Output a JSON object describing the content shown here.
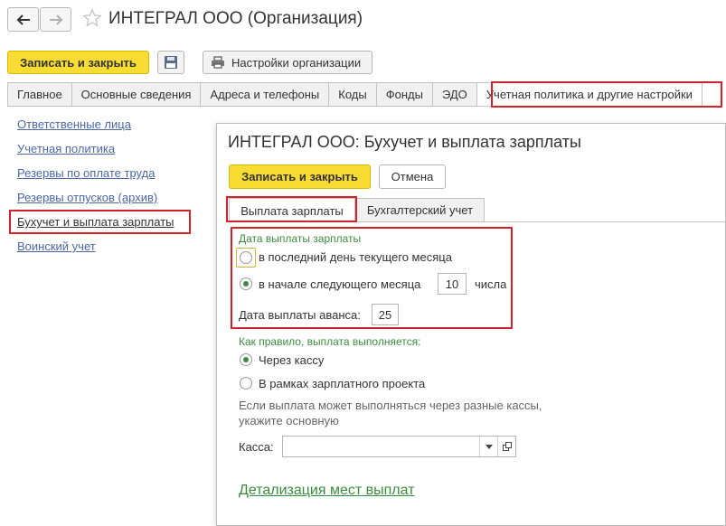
{
  "window": {
    "title": "ИНТЕГРАЛ ООО (Организация)"
  },
  "toolbar": {
    "save_close_label": "Записать и закрыть",
    "settings_label": "Настройки организации"
  },
  "tabs": [
    {
      "label": "Главное"
    },
    {
      "label": "Основные сведения"
    },
    {
      "label": "Адреса и телефоны"
    },
    {
      "label": "Коды"
    },
    {
      "label": "Фонды"
    },
    {
      "label": "ЭДО"
    },
    {
      "label": "Учетная политика и другие настройки"
    }
  ],
  "sidebar": {
    "items": [
      {
        "label": "Ответственные лица"
      },
      {
        "label": "Учетная политика"
      },
      {
        "label": "Резервы по оплате труда"
      },
      {
        "label": "Резервы отпусков (архив)"
      },
      {
        "label": "Бухучет и выплата зарплаты"
      },
      {
        "label": "Воинский учет"
      }
    ]
  },
  "dialog": {
    "title": "ИНТЕГРАЛ ООО: Бухучет и выплата зарплаты",
    "save_close_label": "Записать и закрыть",
    "cancel_label": "Отмена",
    "tabs": [
      {
        "label": "Выплата зарплаты"
      },
      {
        "label": "Бухгалтерский учет"
      }
    ],
    "pay_date_header": "Дата выплаты зарплаты",
    "option_last_day": "в последний день текущего месяца",
    "option_next_month": "в начале следующего месяца",
    "day_value": "10",
    "day_suffix": "числа",
    "advance_label": "Дата выплаты аванса:",
    "advance_value": "25",
    "method_header": "Как правило, выплата выполняется:",
    "method_cash": "Через кассу",
    "method_project": "В рамках зарплатного проекта",
    "hint_line1": "Если выплата может выполняться через разные кассы,",
    "hint_line2": "укажите основную",
    "kassa_label": "Касса:",
    "kassa_value": "",
    "details_link": "Детализация мест выплат"
  },
  "colors": {
    "accent_yellow": "#f8dc34",
    "highlight_red": "#d1232a",
    "green_text": "#3b8d3e",
    "link_blue": "#4a68a8"
  }
}
